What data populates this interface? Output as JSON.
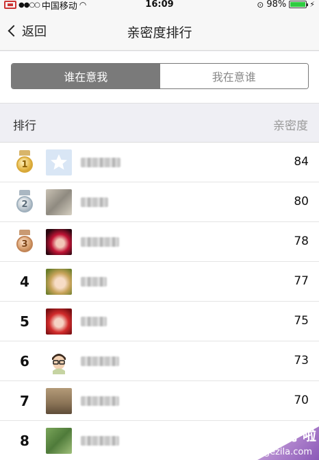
{
  "status_bar": {
    "carrier": "中国移动",
    "time": "16:09",
    "battery": "98%",
    "battery_level": 0.98
  },
  "nav": {
    "back_label": "返回",
    "title": "亲密度排行"
  },
  "segmented": {
    "items": [
      {
        "label": "谁在意我",
        "selected": true
      },
      {
        "label": "我在意谁",
        "selected": false
      }
    ]
  },
  "list": {
    "header_rank": "排行",
    "header_score": "亲密度",
    "rows": [
      {
        "rank": "1",
        "medal": "gold",
        "avatar": "star-placeholder-avatar",
        "score": "84"
      },
      {
        "rank": "2",
        "medal": "silver",
        "avatar": "blurred-avatar",
        "score": "80"
      },
      {
        "rank": "3",
        "medal": "bronze",
        "avatar": "red-hair-avatar",
        "score": "78"
      },
      {
        "rank": "4",
        "medal": null,
        "avatar": "anime-girl-avatar",
        "score": "77"
      },
      {
        "rank": "5",
        "medal": null,
        "avatar": "red-girl-avatar",
        "score": "75"
      },
      {
        "rank": "6",
        "medal": null,
        "avatar": "glasses-boy-avatar",
        "score": "73"
      },
      {
        "rank": "7",
        "medal": null,
        "avatar": "couple-avatar",
        "score": "70"
      },
      {
        "rank": "8",
        "medal": null,
        "avatar": "green-photo-avatar",
        "score": ""
      }
    ]
  },
  "watermark": {
    "text": "格子啦",
    "url": "gezila.com"
  }
}
